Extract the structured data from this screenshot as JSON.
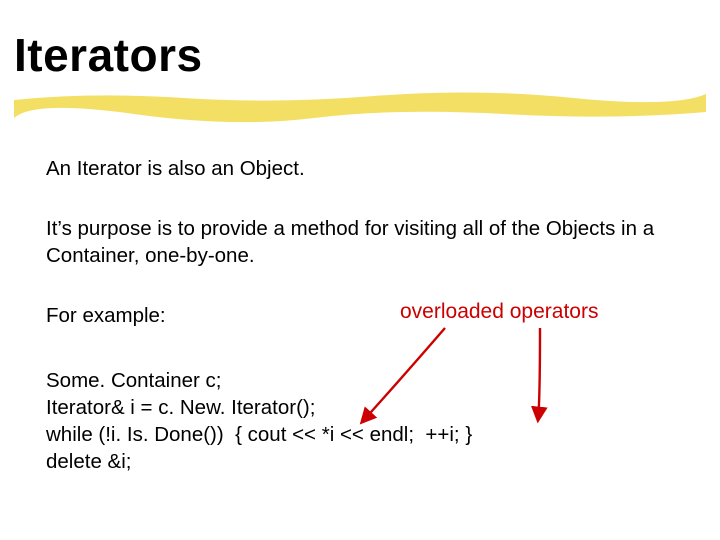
{
  "title": "Iterators",
  "paragraphs": {
    "p1": "An Iterator is also an Object.",
    "p2": "It’s purpose is to provide a method for visiting all of the Objects in a Container, one-by-one.",
    "p3": "For example:"
  },
  "annotation": "overloaded operators",
  "code": {
    "line1": "Some. Container c;",
    "line2": "Iterator& i = c. New. Iterator();",
    "line3": "while (!i. Is. Done())  { cout << *i << endl;  ++i; }",
    "line4": "delete &i;"
  },
  "colors": {
    "accent_red": "#cc0000",
    "underline_yellow": "#f2d94a"
  }
}
